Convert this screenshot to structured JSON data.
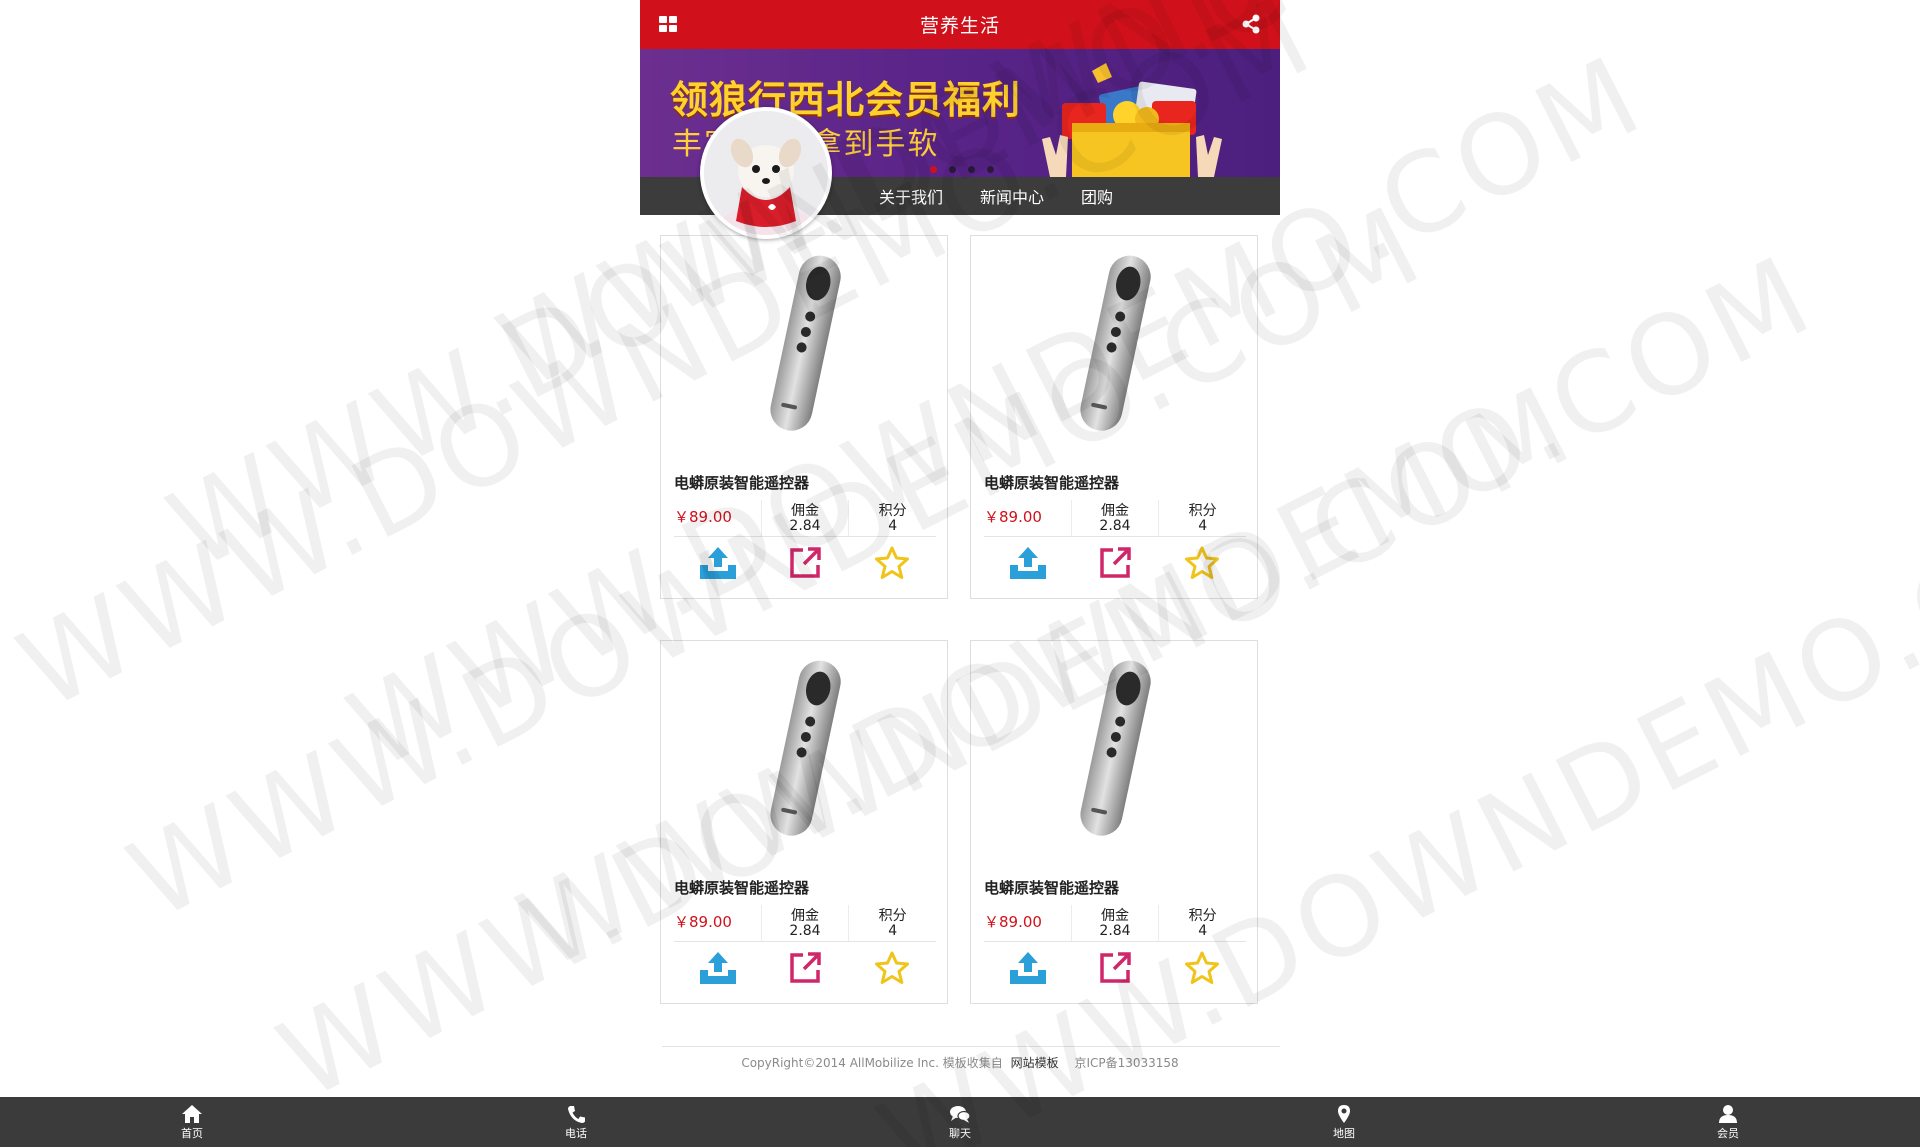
{
  "header": {
    "title": "营养生活",
    "menu_icon": "grid-menu-icon",
    "share_icon": "share-icon"
  },
  "banner": {
    "headline": "领狼行西北会员福利",
    "subline": "丰富好礼 拿到手软",
    "slides": 4,
    "active_slide": 1
  },
  "subnav": {
    "items": [
      {
        "label": "关于我们"
      },
      {
        "label": "新闻中心"
      },
      {
        "label": "团购"
      }
    ]
  },
  "products": [
    {
      "name": "电蟒原装智能遥控器",
      "price": "￥89.00",
      "commission_label": "佣金",
      "commission": "2.84",
      "points_label": "积分",
      "points": "4"
    },
    {
      "name": "电蟒原装智能遥控器",
      "price": "￥89.00",
      "commission_label": "佣金",
      "commission": "2.84",
      "points_label": "积分",
      "points": "4"
    },
    {
      "name": "电蟒原装智能遥控器",
      "price": "￥89.00",
      "commission_label": "佣金",
      "commission": "2.84",
      "points_label": "积分",
      "points": "4"
    },
    {
      "name": "电蟒原装智能遥控器",
      "price": "￥89.00",
      "commission_label": "佣金",
      "commission": "2.84",
      "points_label": "积分",
      "points": "4"
    }
  ],
  "footer": {
    "copyright": "CopyRight©2014 AllMobilize Inc. 模板收集自",
    "link": "网站模板",
    "icp": "京ICP备13033158"
  },
  "tabbar": {
    "items": [
      {
        "label": "首页",
        "icon": "home-icon"
      },
      {
        "label": "电话",
        "icon": "phone-icon"
      },
      {
        "label": "聊天",
        "icon": "chat-icon"
      },
      {
        "label": "地图",
        "icon": "map-pin-icon"
      },
      {
        "label": "会员",
        "icon": "user-icon"
      }
    ]
  },
  "watermark": "WWW.DOWNDEMO.COM",
  "colors": {
    "brand_red": "#d0111b",
    "dark_bar": "#3c3c3c",
    "action_blue": "#2a9fd8",
    "action_pink": "#d0266a",
    "action_gold": "#f0c419"
  }
}
